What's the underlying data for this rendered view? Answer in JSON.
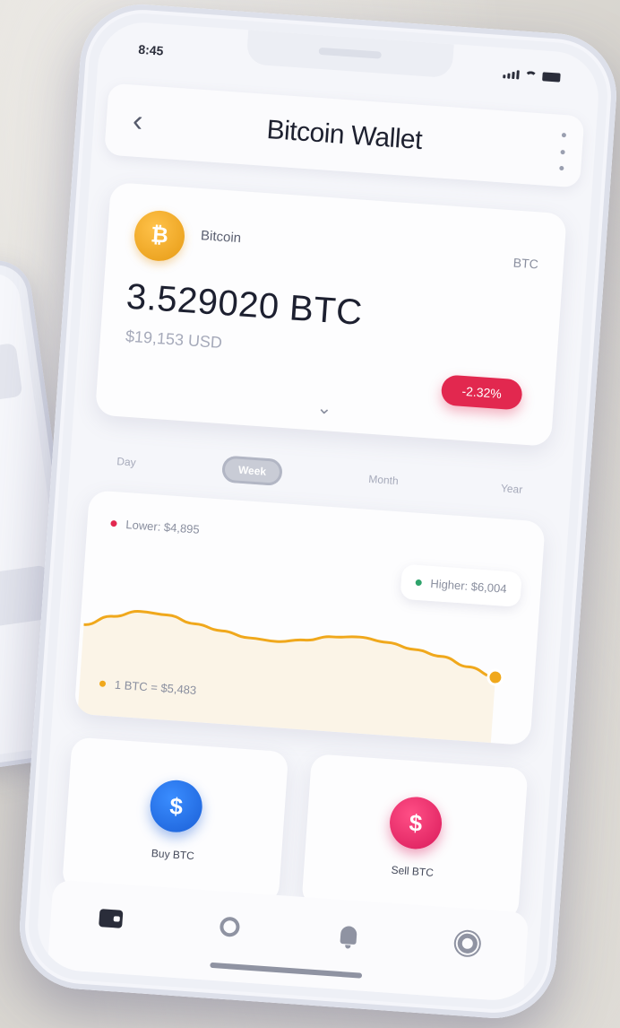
{
  "status": {
    "time": "8:45"
  },
  "header": {
    "title": "Bitcoin Wallet"
  },
  "wallet": {
    "coin_name": "Bitcoin",
    "ticker": "BTC",
    "balance": "3.529020 BTC",
    "balance_usd": "$19,153 USD",
    "change": "-2.32%"
  },
  "periods": {
    "tabs": [
      {
        "label": "Day"
      },
      {
        "label": "Week"
      },
      {
        "label": "Month"
      },
      {
        "label": "Year"
      }
    ],
    "active": "Week"
  },
  "chart": {
    "low_label": "Lower: $4,895",
    "high_label": "Higher: $6,004",
    "rate_label": "1 BTC = $5,483",
    "low_color": "#e2284f",
    "high_color": "#2fa36b",
    "rate_color": "#f0a81c",
    "line_color": "#f0a81c"
  },
  "chart_data": {
    "type": "line",
    "series": [
      {
        "values": [
          42,
          48,
          52,
          51,
          47,
          44,
          41,
          40,
          42,
          45,
          46,
          44,
          41,
          38,
          33,
          28
        ]
      }
    ],
    "ylim": [
      0,
      100
    ],
    "grid": false
  },
  "actions": {
    "buy": {
      "label": "Buy BTC",
      "icon": "dollar-icon"
    },
    "sell": {
      "label": "Sell BTC",
      "icon": "dollar-icon"
    }
  },
  "tabbar": {
    "items": [
      "wallet-icon",
      "compass-icon",
      "bell-icon",
      "gear-icon"
    ]
  }
}
